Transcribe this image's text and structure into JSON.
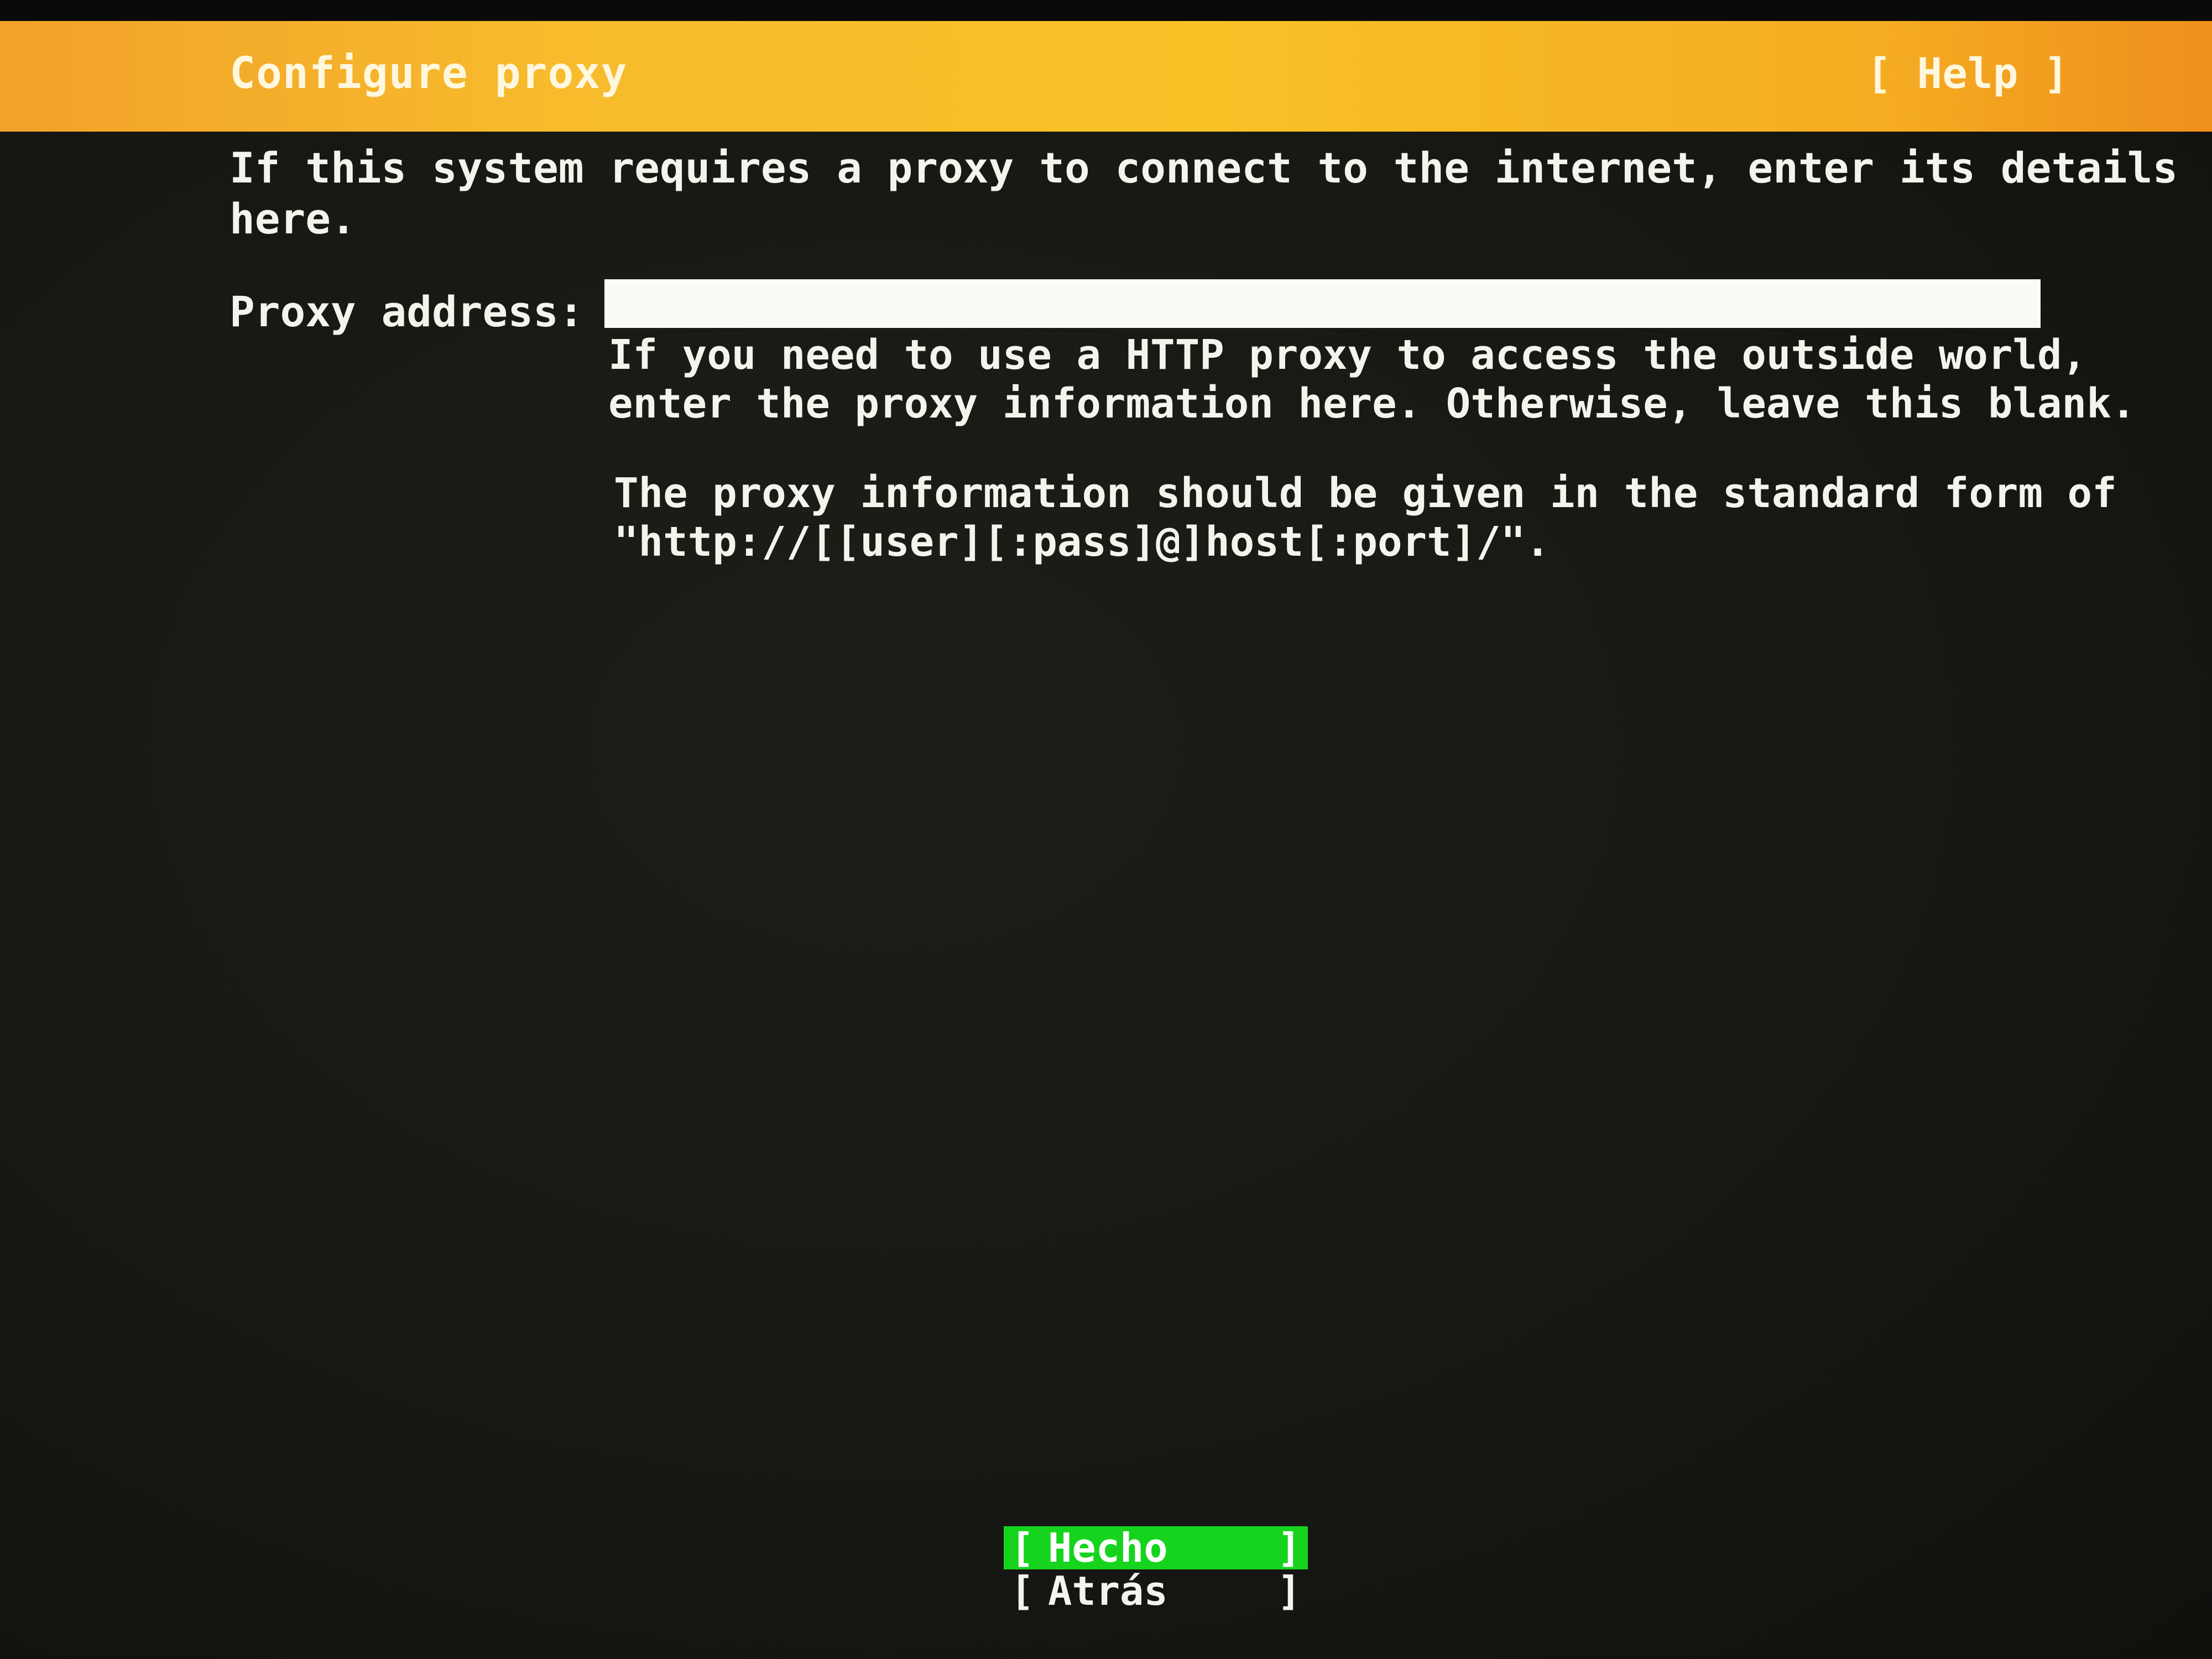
{
  "header": {
    "title": "Configure proxy",
    "help_label": "[ Help ]"
  },
  "intro_text": "If this system requires a proxy to connect to the internet, enter its details\nhere.",
  "proxy": {
    "label": "Proxy address:",
    "value": "",
    "help_line_1": "If you need to use a HTTP proxy to access the outside world,\nenter the proxy information here. Otherwise, leave this blank.",
    "help_line_2": "The proxy information should be given in the standard form of\n\"http://[[user][:pass]@]host[:port]/\"."
  },
  "buttons": {
    "done_label": "Hecho",
    "back_label": "Atrás",
    "bracket_open": "[",
    "bracket_close": "]"
  },
  "colors": {
    "header_accent": "#f7bb2c",
    "focus_button": "#16d41e",
    "background": "#161612"
  }
}
